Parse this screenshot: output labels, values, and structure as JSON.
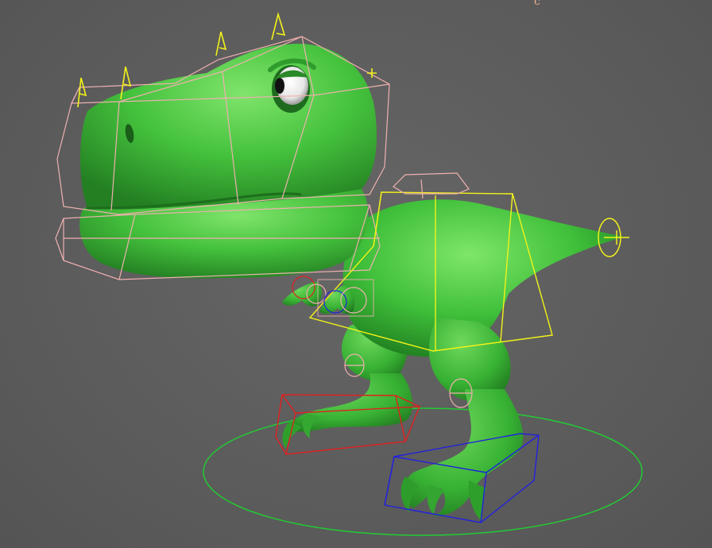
{
  "viewport": {
    "corner_text": "c"
  },
  "colors": {
    "background": "#5c5c5c",
    "body_green": "#3fbf3a",
    "body_green_light": "#6bdc5a",
    "body_green_dark": "#1f7d1f",
    "control_pink": "#f0b0b0",
    "control_yellow": "#f2f21a",
    "control_red": "#e02020",
    "control_blue": "#2222dd",
    "ground_circle": "#22cc33"
  },
  "scene_objects": [
    "trex-character",
    "head-control",
    "jaw-control",
    "spine-control",
    "tail-control",
    "left-foot-control",
    "right-foot-control",
    "root-control"
  ]
}
